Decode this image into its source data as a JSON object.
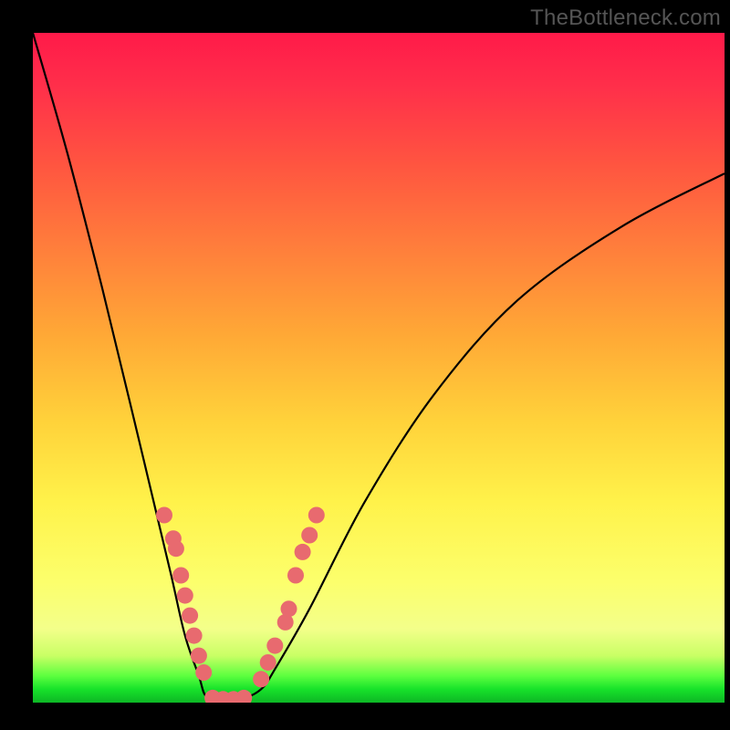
{
  "watermark": "TheBottleneck.com",
  "chart_data": {
    "type": "line",
    "title": "",
    "xlabel": "",
    "ylabel": "",
    "xlim": [
      0,
      100
    ],
    "ylim": [
      0,
      100
    ],
    "series": [
      {
        "name": "curve",
        "x": [
          0,
          5,
          10,
          14,
          17,
          20,
          22,
          24,
          25,
          27,
          30,
          33,
          35,
          40,
          48,
          58,
          70,
          85,
          100
        ],
        "y": [
          100,
          82,
          62,
          45,
          32,
          19,
          10,
          4,
          1,
          0.5,
          0.5,
          2,
          5,
          14,
          30,
          46,
          60,
          71,
          79
        ]
      }
    ],
    "markers": {
      "left_branch": [
        {
          "x": 19.0,
          "y": 28.0
        },
        {
          "x": 20.3,
          "y": 24.5
        },
        {
          "x": 20.7,
          "y": 23.0
        },
        {
          "x": 21.4,
          "y": 19.0
        },
        {
          "x": 22.0,
          "y": 16.0
        },
        {
          "x": 22.7,
          "y": 13.0
        },
        {
          "x": 23.3,
          "y": 10.0
        },
        {
          "x": 24.0,
          "y": 7.0
        },
        {
          "x": 24.7,
          "y": 4.5
        }
      ],
      "valley": [
        {
          "x": 26.0,
          "y": 0.7
        },
        {
          "x": 27.5,
          "y": 0.5
        },
        {
          "x": 29.0,
          "y": 0.5
        },
        {
          "x": 30.5,
          "y": 0.7
        }
      ],
      "right_branch": [
        {
          "x": 33.0,
          "y": 3.5
        },
        {
          "x": 34.0,
          "y": 6.0
        },
        {
          "x": 35.0,
          "y": 8.5
        },
        {
          "x": 36.5,
          "y": 12.0
        },
        {
          "x": 37.0,
          "y": 14.0
        },
        {
          "x": 38.0,
          "y": 19.0
        },
        {
          "x": 39.0,
          "y": 22.5
        },
        {
          "x": 40.0,
          "y": 25.0
        },
        {
          "x": 41.0,
          "y": 28.0
        }
      ]
    },
    "marker_style": {
      "fill": "#e86a6f",
      "r": 9
    },
    "curve_style": {
      "stroke": "#000000",
      "width": 2.2
    }
  }
}
